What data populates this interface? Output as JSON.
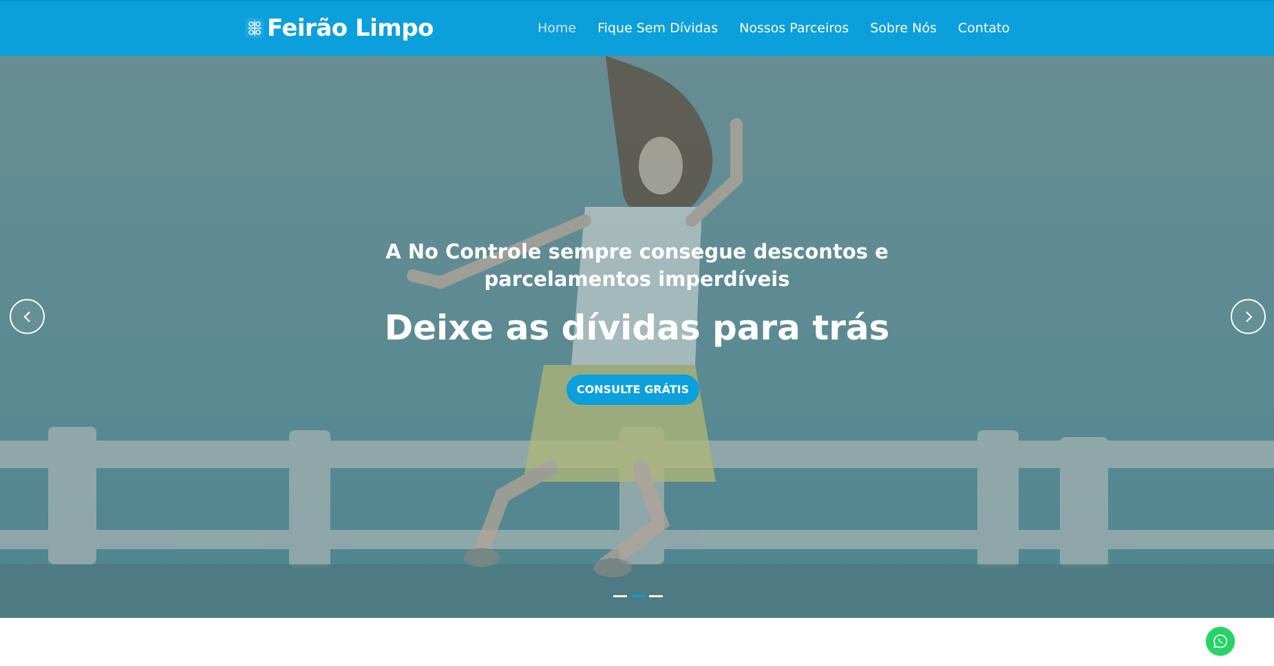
{
  "brand": {
    "name": "Feirão Limpo",
    "logo_icon": "brain-circuit-icon"
  },
  "nav": {
    "items": [
      {
        "label": "Home",
        "active": true
      },
      {
        "label": "Fique Sem Dívidas",
        "active": false
      },
      {
        "label": "Nossos Parceiros",
        "active": false
      },
      {
        "label": "Sobre Nós",
        "active": false
      },
      {
        "label": "Contato",
        "active": false
      }
    ]
  },
  "hero": {
    "subtitle": "A No Controle sempre consegue descontos e parcelamentos imperdíveis",
    "headline": "Deixe as dívidas para trás",
    "cta_label": "CONSULTE GRÁTIS",
    "prev_icon": "chevron-left-icon",
    "next_icon": "chevron-right-icon",
    "slides_count": 3,
    "active_slide": 2
  },
  "floating": {
    "whatsapp_icon": "whatsapp-icon"
  },
  "colors": {
    "primary": "#0b9fdb",
    "nav_active": "#cfe6ef",
    "whatsapp": "#25d366",
    "text_on_primary": "#ffffff"
  }
}
